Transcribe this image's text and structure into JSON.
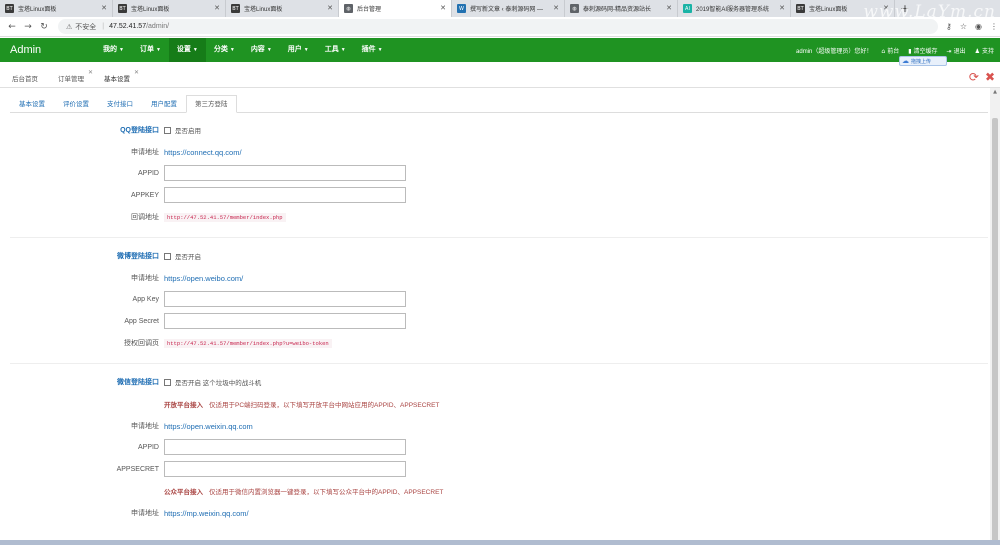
{
  "browser": {
    "tabs": [
      {
        "label": "宝塔Linux面板",
        "favicon": "BT",
        "favicon_color": "#3a3a3a"
      },
      {
        "label": "宝塔Linux面板",
        "favicon": "BT",
        "favicon_color": "#3a3a3a"
      },
      {
        "label": "宝塔Linux面板",
        "favicon": "BT",
        "favicon_color": "#3a3a3a"
      },
      {
        "label": "后台管理",
        "favicon": "globe-icon",
        "favicon_color": "#5f6368",
        "active": true
      },
      {
        "label": "撰写新文章 ‹ 泰刺源码网 —",
        "favicon": "W",
        "favicon_color": "#2271b1"
      },
      {
        "label": "泰刺源码网-精品资源站长",
        "favicon": "globe-icon",
        "favicon_color": "#5f6368"
      },
      {
        "label": "2019智能AI服务器管理系统",
        "favicon": "AI",
        "favicon_color": "#1ab3a6"
      },
      {
        "label": "宝塔Linux面板",
        "favicon": "BT",
        "favicon_color": "#3a3a3a"
      }
    ],
    "new_tab": "+",
    "watermark": "www.LaYm.cn",
    "address": {
      "insecure_label": "不安全",
      "separator": "|",
      "host": "47.52.41.57",
      "path": "/admin/"
    }
  },
  "app": {
    "brand": "Admin",
    "accent": "#1f9322",
    "menu": [
      {
        "label": "我的"
      },
      {
        "label": "订单"
      },
      {
        "label": "设置",
        "active": true
      },
      {
        "label": "分类"
      },
      {
        "label": "内容"
      },
      {
        "label": "用户"
      },
      {
        "label": "工具"
      },
      {
        "label": "插件"
      }
    ],
    "user_greeting": "admin（超级管理员）您好！",
    "right_links": [
      {
        "label": "前台",
        "icon": "home-icon"
      },
      {
        "label": "清空缓存",
        "icon": "trash-icon"
      },
      {
        "label": "退出",
        "icon": "logout-icon"
      },
      {
        "label": "支持",
        "icon": "user-icon"
      }
    ],
    "upload_badge": "拖拽上传"
  },
  "page_tabs": [
    {
      "label": "后台首页"
    },
    {
      "label": "订单管理",
      "closable": true
    },
    {
      "label": "基本设置",
      "closable": true,
      "active": true
    }
  ],
  "content_tabs": [
    {
      "label": "基本设置"
    },
    {
      "label": "评价设置"
    },
    {
      "label": "支付接口"
    },
    {
      "label": "用户配置"
    },
    {
      "label": "第三方登陆",
      "active": true
    }
  ],
  "qq": {
    "title": "QQ登陆接口",
    "enable_label": "是否启用",
    "apply_label": "申请地址",
    "apply_url": "https://connect.qq.com/",
    "appid_label": "APPID",
    "appkey_label": "APPKEY",
    "callback_label": "回调地址",
    "callback_url": "http://47.52.41.57/member/index.php"
  },
  "weibo": {
    "title": "微博登陆接口",
    "enable_label": "是否开启",
    "apply_label": "申请地址",
    "apply_url": "https://open.weibo.com/",
    "appkey_label": "App Key",
    "secret_label": "App Secret",
    "callback_label": "授权回调页",
    "callback_url": "http://47.52.41.57/member/index.php?u=weibo-token"
  },
  "wechat": {
    "title": "微信登陆接口",
    "enable_label": "是否开启 这个垃圾中的战斗机",
    "open_platform_title": "开放平台接入",
    "open_platform_note": "仅适用于PC端扫码登录，以下填写开放平台中网站应用的APPID、APPSECRET",
    "apply_label": "申请地址",
    "open_apply_url": "https://open.weixin.qq.com",
    "appid_label": "APPID",
    "appsecret_label": "APPSECRET",
    "mp_platform_title": "公众平台接入",
    "mp_platform_note": "仅适用于微信内置浏览器一键登录，以下填写公众平台中的APPID、APPSECRET",
    "mp_apply_url": "https://mp.weixin.qq.com/"
  }
}
